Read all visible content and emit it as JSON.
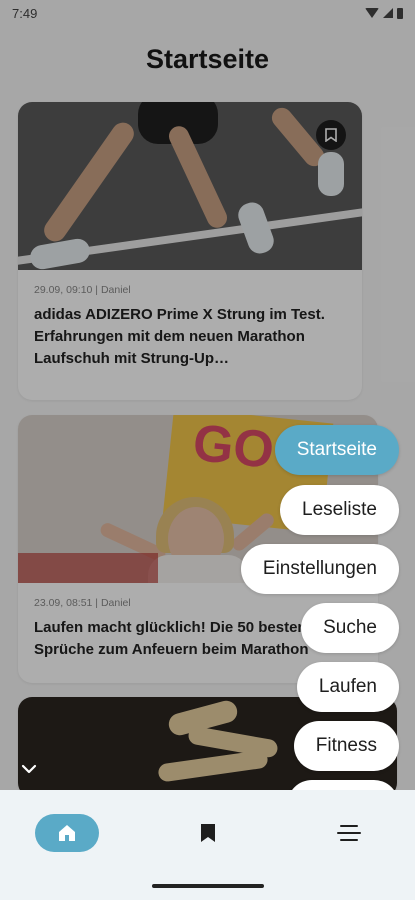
{
  "status": {
    "time": "7:49"
  },
  "page": {
    "title": "Startseite"
  },
  "articles": [
    {
      "meta": "29.09, 09:10 | Daniel",
      "headline": "adidas ADIZERO Prime X Strung im Test. Erfahrungen mit dem neuen Marathon Laufschuh mit Strung-Up…"
    },
    {
      "meta": "23.09, 08:51 | Daniel",
      "headline": "Laufen macht glücklich! Die 50 besten Sprüche zum Anfeuern beim Marathon",
      "image_text": "GO"
    },
    {
      "meta": "",
      "headline": ""
    }
  ],
  "fab_menu": {
    "items": [
      {
        "label": "Startseite",
        "active": true
      },
      {
        "label": "Leseliste"
      },
      {
        "label": "Einstellungen"
      },
      {
        "label": "Suche"
      },
      {
        "label": "Laufen"
      },
      {
        "label": "Fitness"
      }
    ]
  },
  "bottom_nav": {
    "items": [
      {
        "icon": "home-icon",
        "active": true
      },
      {
        "icon": "bookmark-icon"
      },
      {
        "icon": "menu-icon"
      }
    ]
  },
  "colors": {
    "accent": "#5aaac7",
    "nav_background": "#eef3f6"
  }
}
